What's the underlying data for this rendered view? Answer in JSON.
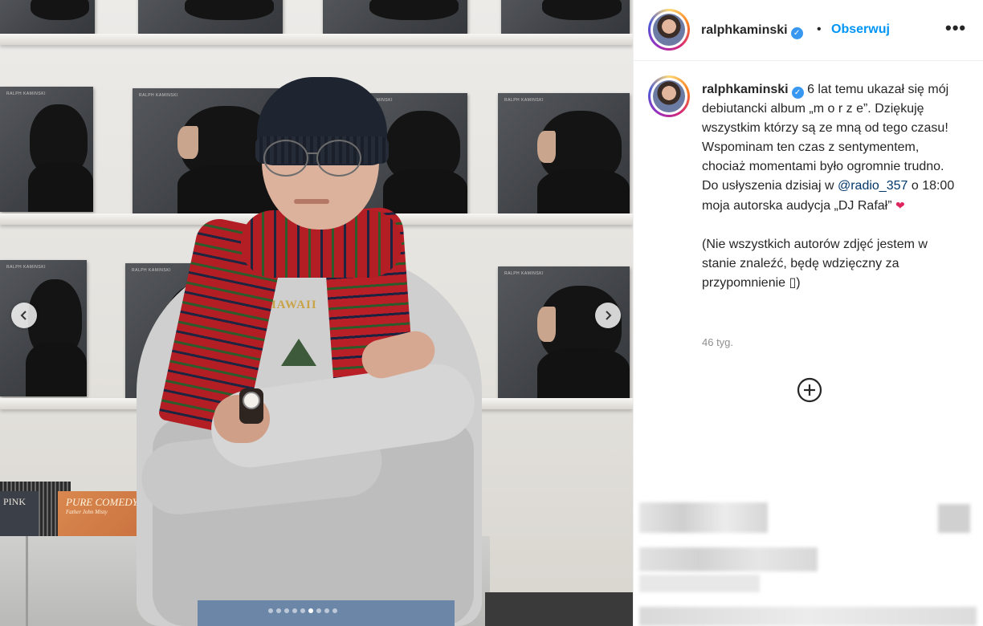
{
  "post": {
    "username": "ralphkaminski",
    "follow_label": "Obserwuj",
    "separator": "•",
    "more_label": "•••",
    "caption_lines": [
      "6 lat temu ukazał się mój debiutancki album „m o r z e”. Dziękuję wszystkim którzy są ze mną od tego czasu! Wspominam ten czas z sentymentem, chociaż momentami było ogromnie trudno.",
      "Do usłyszenia dzisiaj w",
      "@radio_357",
      "o 18:00 moja autorska audycja „DJ Rafał”",
      "(Nie wszystkich autorów zdjęć jestem w stanie znaleźć, będę wdzięczny za przypomnienie ▯)"
    ],
    "time_ago": "46 tyg.",
    "heart_icon": "❤",
    "carousel_dot_count": 9,
    "carousel_active_index": 5
  },
  "photo": {
    "album_label": "RALPH KAMINSKI",
    "vinyl_pink": "PINK",
    "vinyl_comedy_title": "PURE COMEDY",
    "vinyl_comedy_sub": "Father John Misty",
    "shirt_text": "HAWAII"
  },
  "icons": {
    "prev": "chevron-left-icon",
    "next": "chevron-right-icon",
    "verified": "verified-badge-icon",
    "add": "plus-circle-icon",
    "options": "more-options-icon"
  },
  "colors": {
    "follow": "#0095f6",
    "verified": "#3897f0",
    "mention": "#00376b",
    "muted": "#8e8e8e"
  }
}
